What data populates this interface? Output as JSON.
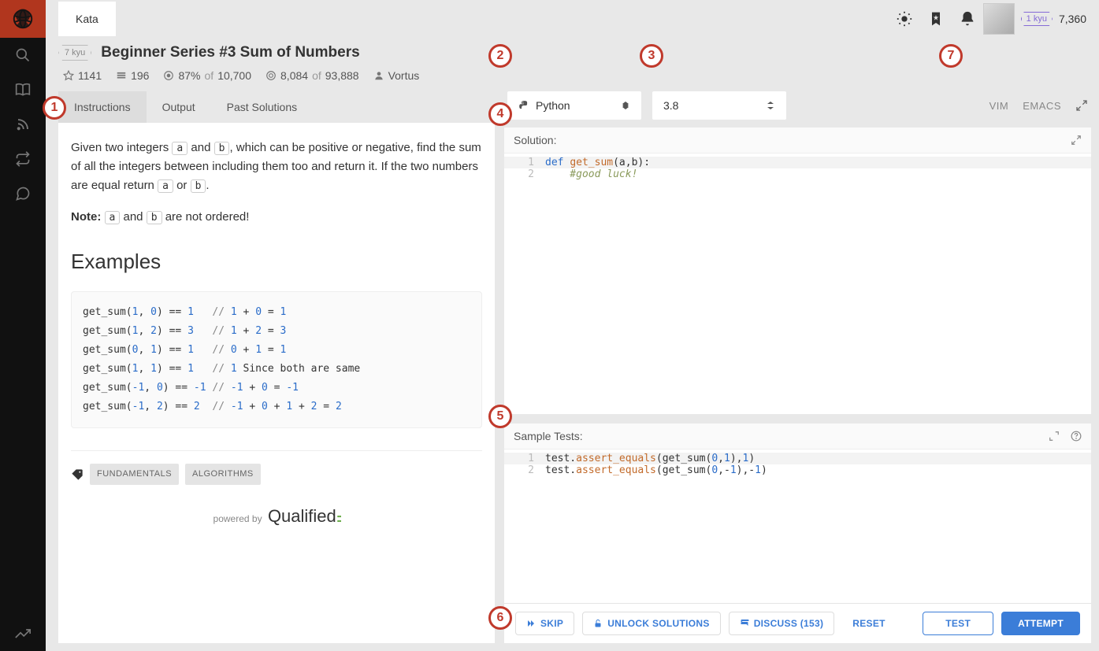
{
  "topbar": {
    "kata_tab": "Kata",
    "user_rank": "1 kyu",
    "honor": "7,360"
  },
  "kata": {
    "kyu": "7 kyu",
    "title": "Beginner Series #3 Sum of Numbers"
  },
  "stats": {
    "stars": "1141",
    "collections": "196",
    "satisfaction_pct": "87%",
    "satisfaction_of": "of",
    "satisfaction_total": "10,700",
    "completed": "8,084",
    "completed_of": "of",
    "completed_total": "93,888",
    "author": "Vortus"
  },
  "left_tabs": {
    "instructions": "Instructions",
    "output": "Output",
    "past": "Past Solutions"
  },
  "description": {
    "p1a": "Given two integers ",
    "code_a": "a",
    "p1b": " and ",
    "code_b": "b",
    "p1c": ", which can be positive or negative, find the sum of all the integers between including them too and return it. If the two numbers are equal return ",
    "p1d": " or ",
    "p1e": ". ",
    "note_label": "Note:",
    "note_text": " are not ordered!",
    "examples_heading": "Examples",
    "tags": [
      "FUNDAMENTALS",
      "ALGORITHMS"
    ],
    "powered_by": "powered by",
    "qualified": "Qualified"
  },
  "examples_code": {
    "l1": "get_sum(1, 0) == 1   // 1 + 0 = 1",
    "l2": "get_sum(1, 2) == 3   // 1 + 2 = 3",
    "l3": "get_sum(0, 1) == 1   // 0 + 1 = 1",
    "l4": "get_sum(1, 1) == 1   // 1 Since both are same",
    "l5": "get_sum(-1, 0) == -1 // -1 + 0 = -1",
    "l6": "get_sum(-1, 2) == 2  // -1 + 0 + 1 + 2 = 2"
  },
  "selectors": {
    "language": "Python",
    "version": "3.8"
  },
  "editor_modes": {
    "vim": "VIM",
    "emacs": "EMACS"
  },
  "panels": {
    "solution_label": "Solution:",
    "tests_label": "Sample Tests:"
  },
  "solution_code": {
    "l1_kw": "def ",
    "l1_fn": "get_sum",
    "l1_rest": "(a,b):",
    "l2": "    #good luck!"
  },
  "tests_code": {
    "l1a": "test.",
    "l1b": "assert_equals",
    "l1c": "(get_sum(",
    "l1d": "0",
    "l1e": ",",
    "l1f": "1",
    "l1g": "),",
    "l1h": "1",
    "l1i": ")",
    "l2a": "test.",
    "l2b": "assert_equals",
    "l2c": "(get_sum(",
    "l2d": "0",
    "l2e": ",-",
    "l2f": "1",
    "l2g": "),-",
    "l2h": "1",
    "l2i": ")"
  },
  "bottombar": {
    "skip": "SKIP",
    "unlock": "UNLOCK SOLUTIONS",
    "discuss": "DISCUSS (153)",
    "reset": "RESET",
    "test": "TEST",
    "attempt": "ATTEMPT"
  },
  "markers": {
    "m1": "1",
    "m2": "2",
    "m3": "3",
    "m4": "4",
    "m5": "5",
    "m6": "6",
    "m7": "7"
  }
}
